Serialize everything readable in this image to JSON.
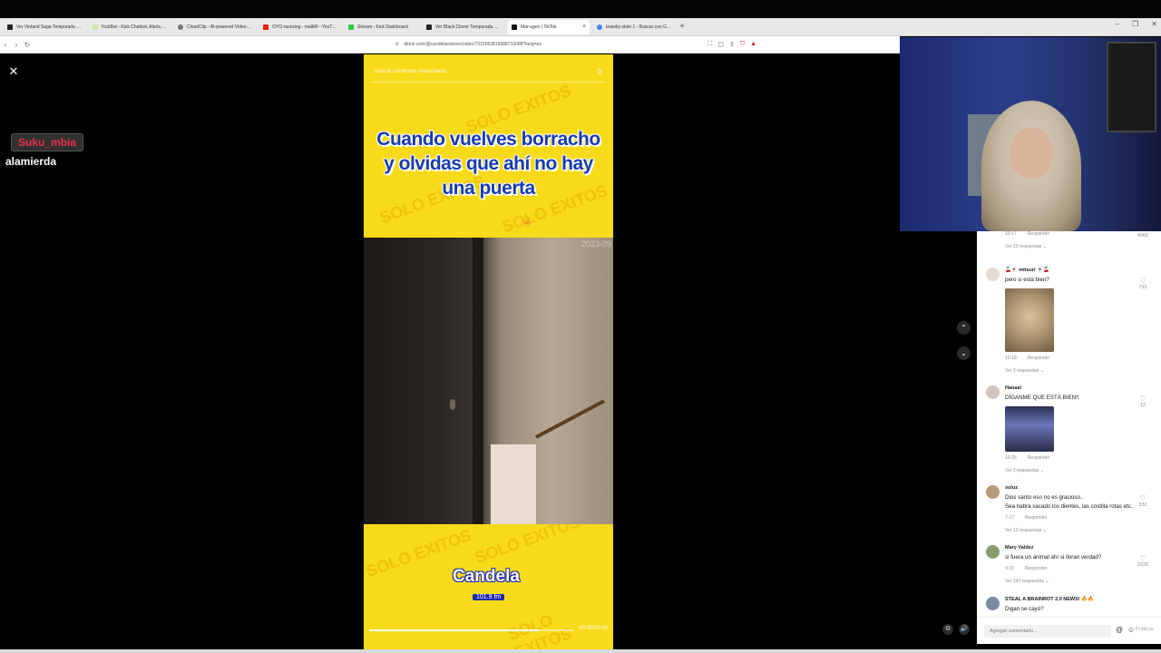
{
  "browser": {
    "tabs": [
      {
        "title": "Ver Vinland Saga Temporada 4 Episodio",
        "color": "#222222",
        "icon": "p-icon"
      },
      {
        "title": "KickBot - Kick Chatbot, Alerts, TTS, Ov",
        "color": "#cfe6a8",
        "icon": "kickbot-icon"
      },
      {
        "title": "CloudClip - AI-powered Video Repurp",
        "color": "#777777",
        "icon": "cloudclip-icon"
      },
      {
        "title": "OYO racexing - malkM - YouTube",
        "color": "#e62117",
        "icon": "youtube-icon"
      },
      {
        "title": "Stream - Kick Dashboard",
        "color": "#2ecc40",
        "icon": "kick-icon"
      },
      {
        "title": "Ver Black Clover Temporada 1 Episod",
        "color": "#222222",
        "icon": "p-icon"
      },
      {
        "title": "Mar-ugeo | TikTok",
        "color": "#111111",
        "icon": "tiktok-icon",
        "active": true
      },
      {
        "title": "brawlry stole 1 - Buscar con Google",
        "color": "#4285f4",
        "icon": "google-icon"
      }
    ],
    "new_tab": "+",
    "window_controls": [
      "–",
      "❐",
      "✕"
    ],
    "url": "tiktok.com/@candelaestereo/video/7315063815688716088?lang=es",
    "nav": {
      "back": "‹",
      "forward": "›",
      "reload": "↻"
    }
  },
  "overlay": {
    "close": "✕",
    "chat_username": "Suku_mbia",
    "chat_message": "alamierda"
  },
  "video": {
    "search_placeholder": "Buscar contenido relacionado",
    "caption_lines": [
      "Cuando vuelves borracho",
      "y olvidas que ahí no hay",
      "una puerta"
    ],
    "watermark": "SOLO EXITOS",
    "cam_timestamp": "2023-09",
    "logo_text": "Candela",
    "logo_freq": "101.9 fm",
    "time": "00:00/00:00",
    "progress": 0.83
  },
  "comments": [
    {
      "user": "",
      "text": "",
      "date": "10-17",
      "reply": "Responder",
      "likes": "4066",
      "more": "Ver 23 respuestas ⌄",
      "thumb": null
    },
    {
      "user": "🍒🍷 mitsuri 🍷🍒",
      "text": "pero si esta bien?",
      "date": "10-18",
      "reply": "Responder",
      "likes": "791",
      "more": "Ver 3 respuestas ⌄",
      "thumb": "cat"
    },
    {
      "user": "Hanaa!",
      "text": "DÍGANME QUE ESTÁ BIEN!!",
      "date": "10-25",
      "reply": "Responder",
      "likes": "12",
      "more": "Ver 2 respuestas ⌄",
      "thumb": "girl"
    },
    {
      "user": "suluz",
      "text": "Dios santo eso no es gracioso..",
      "text2": "Sea habrá sacado los dientes, las costilla rotas etc.",
      "date": "7-17",
      "reply": "Responder",
      "likes": "332",
      "more": "Ver 13 respuestas ⌄",
      "thumb": null
    },
    {
      "user": "Mary Valdez",
      "text": "si fuera un animal ahí si lloran verdad?",
      "date": "9-15",
      "reply": "Responder",
      "likes": "2225",
      "more": "Ver 242 respuestas ⌄",
      "thumb": null
    },
    {
      "user": "STEAL A BRAINROT 2.0 NEWS! 🔥🔥",
      "text": "Digan se cayó?",
      "date": "",
      "reply": "",
      "likes": "",
      "more": "",
      "thumb": null
    }
  ],
  "comment_bar": {
    "placeholder": "Agregar comentario...",
    "mention_icon": "@",
    "emoji_icon": "☺",
    "publish": "Publicar"
  },
  "controls": {
    "up": "⌃",
    "down": "⌄",
    "volume": "🔊",
    "cc": "⧉"
  },
  "colors": {
    "video_yellow": "#f7da1a",
    "caption_blue": "#173caf",
    "chat_name": "#e8304f"
  }
}
